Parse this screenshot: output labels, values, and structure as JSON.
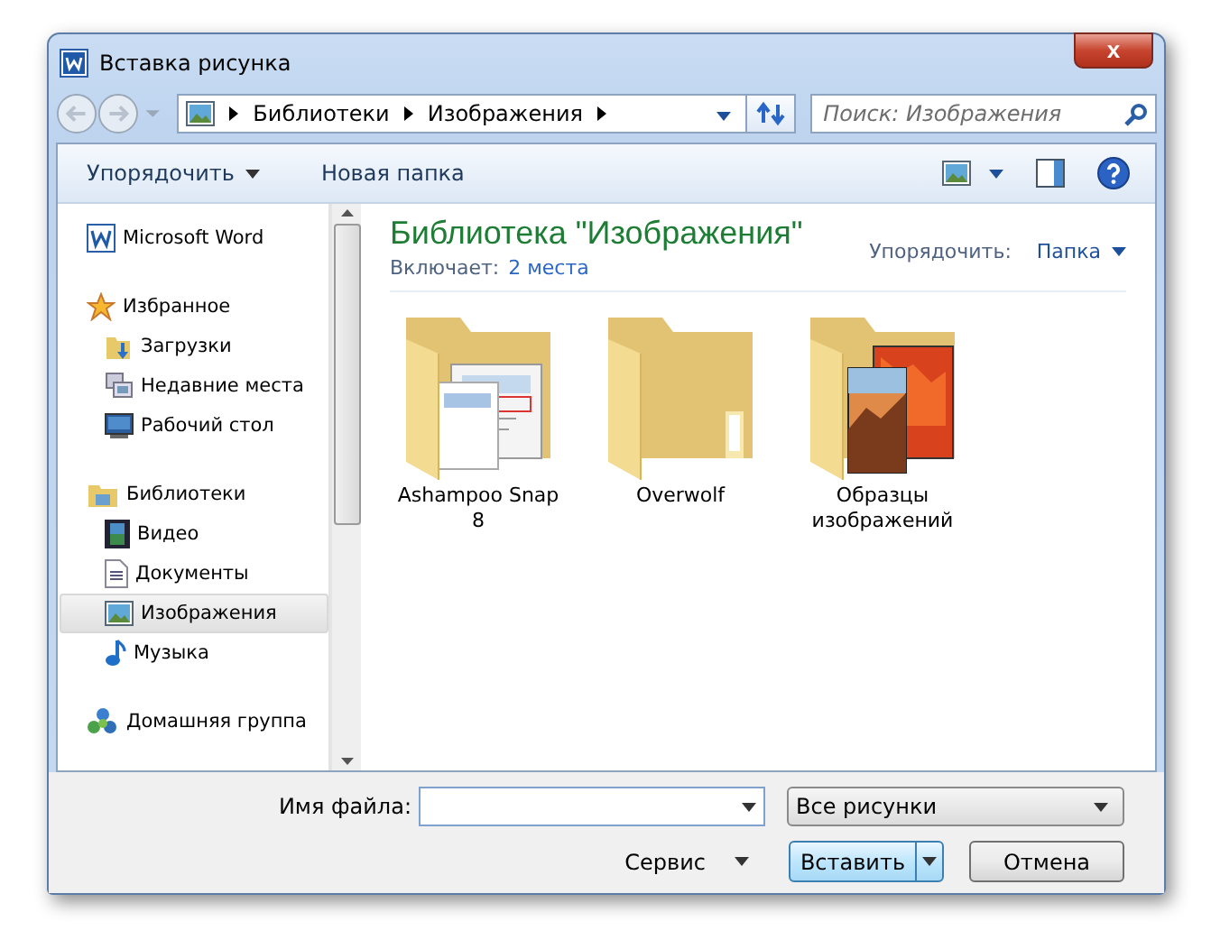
{
  "window": {
    "title": "Вставка рисунка",
    "close_label": "x"
  },
  "address": {
    "segments": [
      "Библиотеки",
      "Изображения"
    ],
    "search_placeholder": "Поиск: Изображения"
  },
  "toolbar": {
    "organize": "Упорядочить",
    "new_folder": "Новая папка"
  },
  "sidebar": {
    "items": [
      {
        "label": "Microsoft Word",
        "selected": false
      },
      {
        "label": "Избранное",
        "selected": false,
        "children": [
          {
            "label": "Загрузки",
            "selected": false
          },
          {
            "label": "Недавние места",
            "selected": false
          },
          {
            "label": "Рабочий стол",
            "selected": false
          }
        ]
      },
      {
        "label": "Библиотеки",
        "selected": false,
        "children": [
          {
            "label": "Видео",
            "selected": false
          },
          {
            "label": "Документы",
            "selected": false
          },
          {
            "label": "Изображения",
            "selected": true
          },
          {
            "label": "Музыка",
            "selected": false
          }
        ]
      },
      {
        "label": "Домашняя группа",
        "selected": false
      }
    ]
  },
  "library": {
    "title": "Библиотека \"Изображения\"",
    "includes_label": "Включает:",
    "includes_link": "2 места",
    "arrange_label": "Упорядочить:",
    "arrange_value": "Папка",
    "items": [
      {
        "name": "Ashampoo Snap 8",
        "kind": "documents"
      },
      {
        "name": "Overwolf",
        "kind": "empty"
      },
      {
        "name": "Образцы изображений",
        "kind": "photos"
      }
    ]
  },
  "footer": {
    "filename_label": "Имя файла:",
    "filter": "Все рисунки",
    "tools": "Сервис",
    "insert": "Вставить",
    "cancel": "Отмена"
  }
}
